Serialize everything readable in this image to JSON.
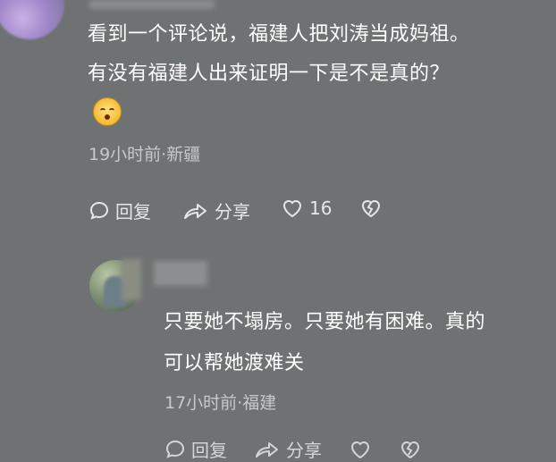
{
  "comment": {
    "line1": "看到一个评论说，福建人把刘涛当成妈祖。",
    "line2": "有没有福建人出来证明一下是不是真的？",
    "emoji_icon": "face-blowing-kiss-icon",
    "meta": "19小时前·新疆",
    "actions": {
      "reply_label": "回复",
      "share_label": "分享",
      "like_count": "16"
    }
  },
  "reply": {
    "line1": "只要她不塌房。只要她有困难。真的",
    "line2": "可以帮她渡难关",
    "meta": "17小时前·福建",
    "actions": {
      "reply_label": "回复",
      "share_label": "分享"
    }
  }
}
